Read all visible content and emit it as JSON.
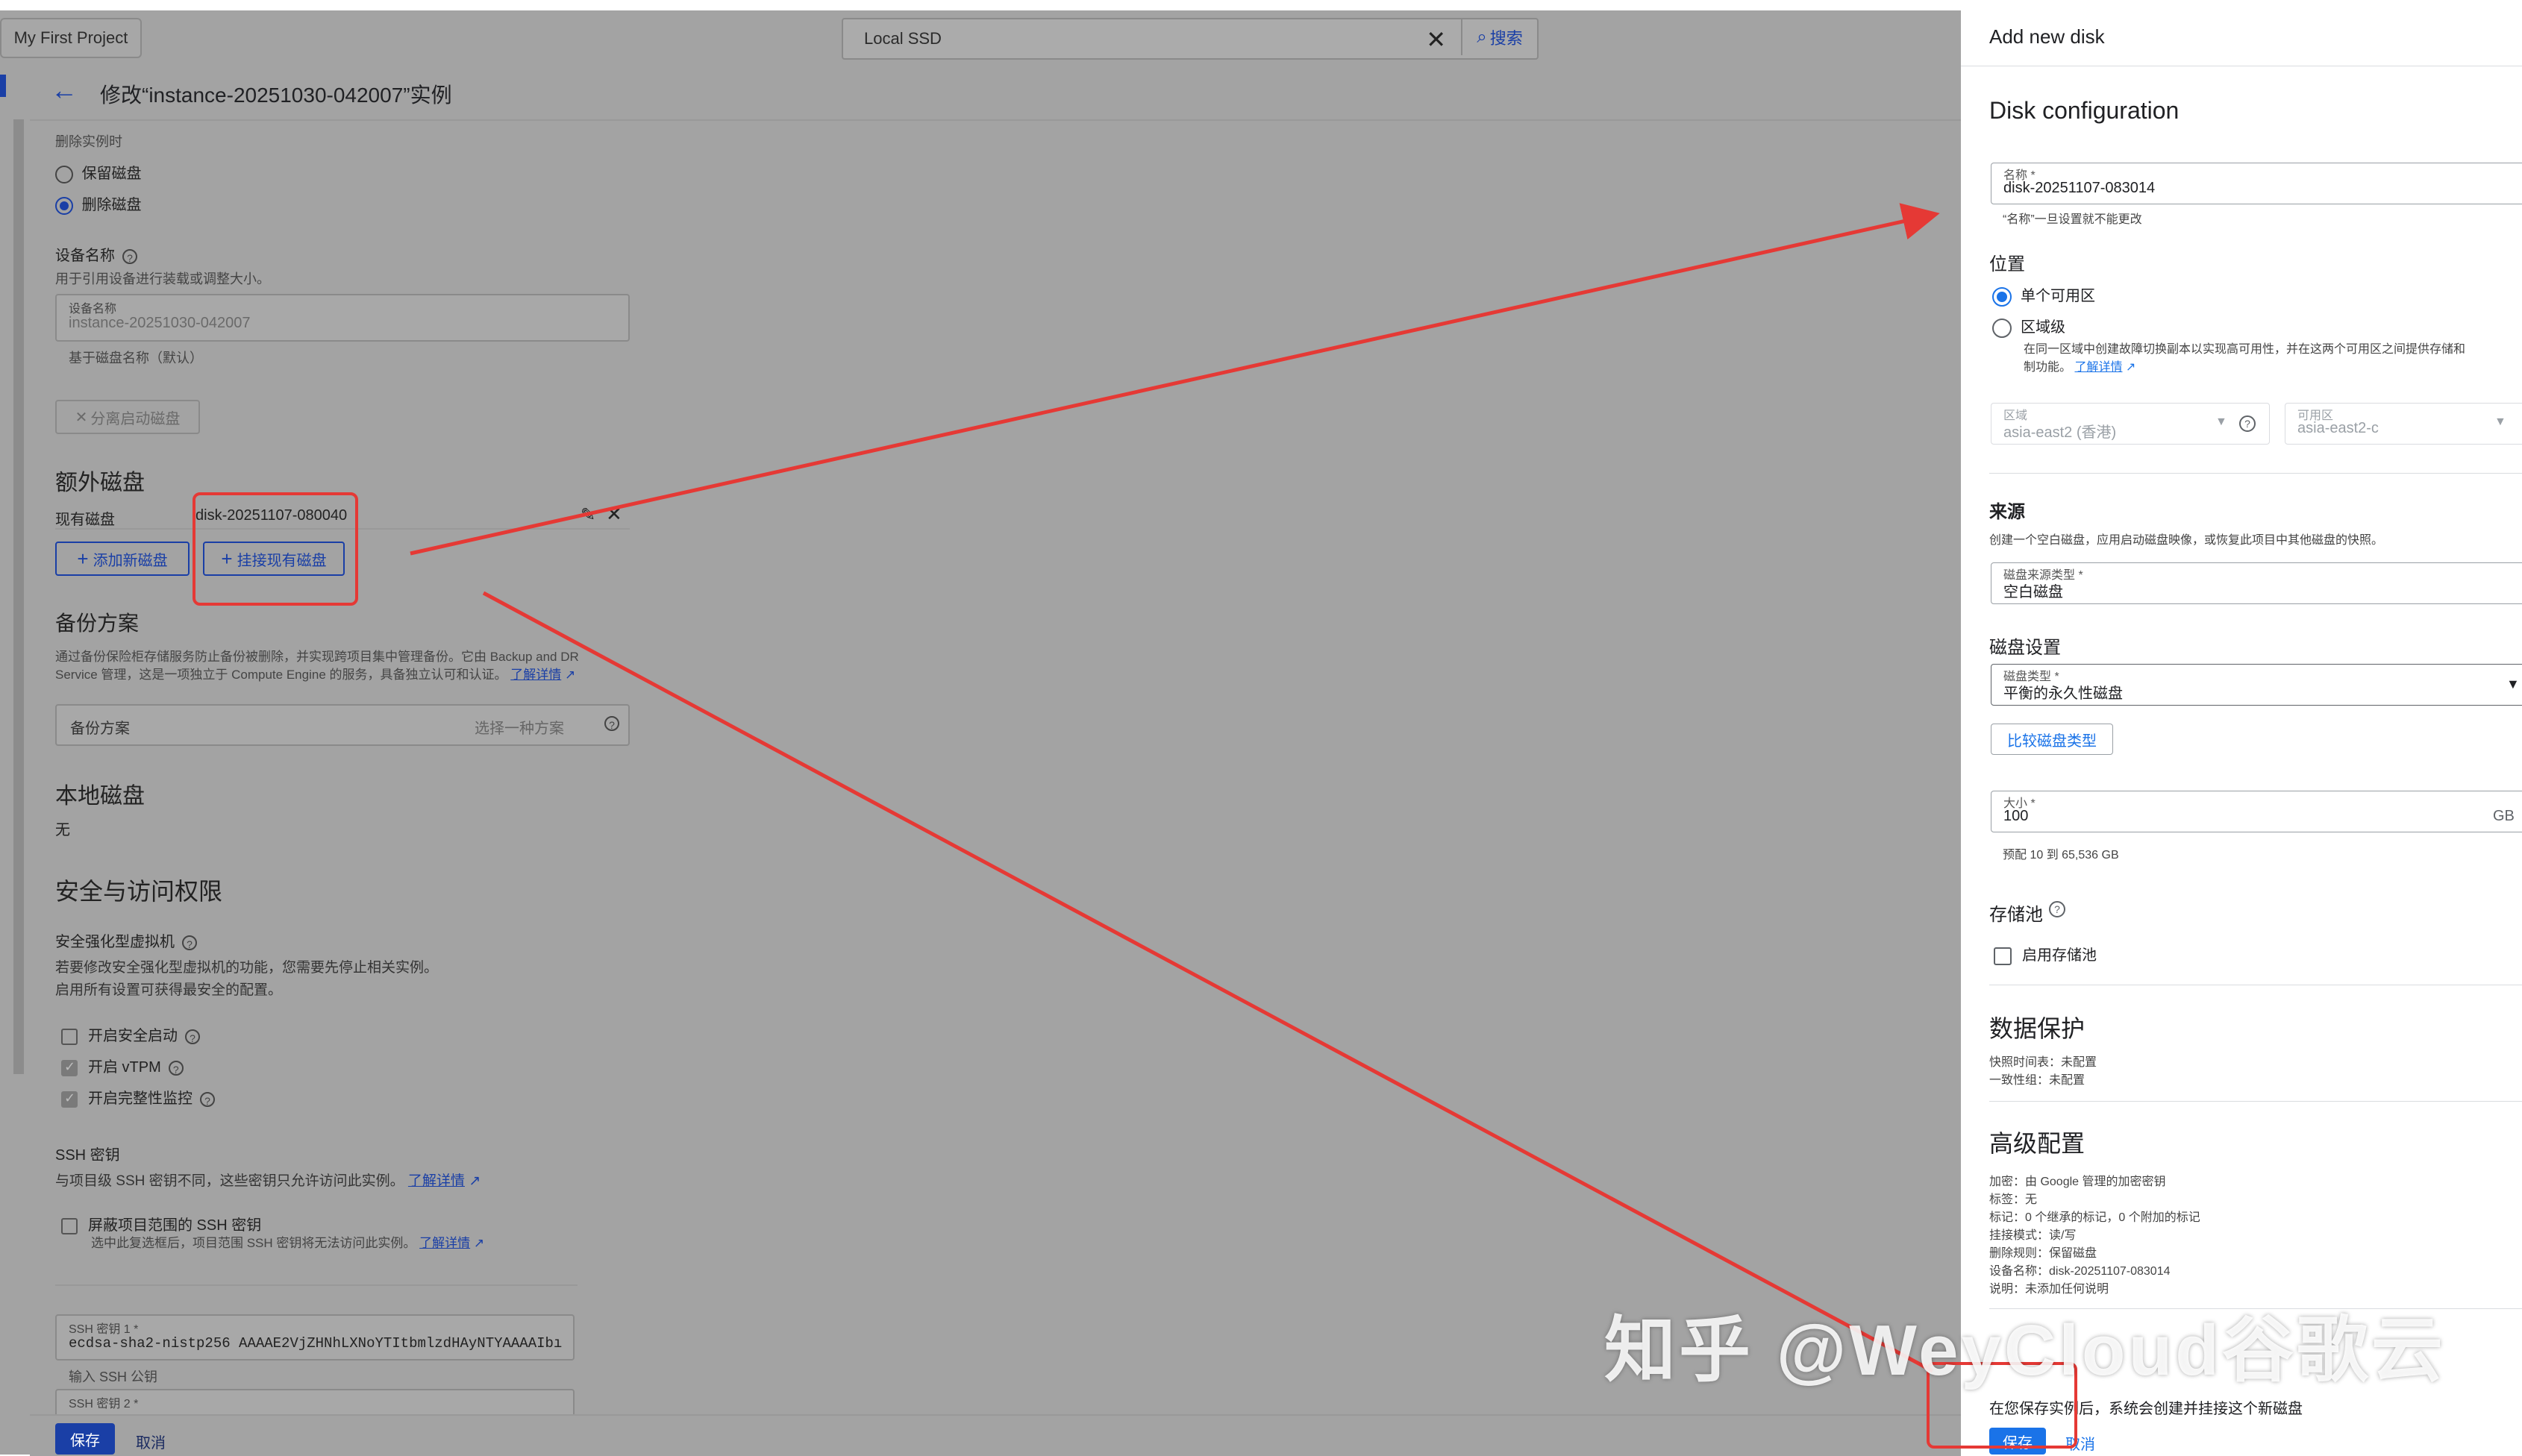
{
  "topbar": {
    "project": "My First Project",
    "search_value": "Local SSD",
    "search_button": "搜索"
  },
  "header": {
    "title": "修改“instance-20251030-042007”实例"
  },
  "delete_rule": {
    "caption": "删除实例时",
    "options": [
      "保留磁盘",
      "删除磁盘"
    ],
    "selected": "删除磁盘"
  },
  "device_name": {
    "title": "设备名称",
    "desc": "用于引用设备进行装载或调整大小。",
    "field_label": "设备名称",
    "field_value": "instance-20251030-042007",
    "hint": "基于磁盘名称（默认）",
    "detach_button": "分离启动磁盘"
  },
  "extra_disks": {
    "title": "额外磁盘",
    "existing_label": "现有磁盘",
    "existing_value": "disk-20251107-080040",
    "add_new": "添加新磁盘",
    "attach_existing": "挂接现有磁盘"
  },
  "backup": {
    "title": "备份方案",
    "desc1": "通过备份保险柜存储服务防止备份被删除，并实现跨项目集中管理备份。它由 Backup and DR",
    "desc2": "Service 管理，这是一项独立于 Compute Engine 的服务，具备独立认可和认证。",
    "learn_more": "了解详情",
    "field_label": "备份方案",
    "field_placeholder": "选择一种方案"
  },
  "local_disk": {
    "title": "本地磁盘",
    "value": "无"
  },
  "security": {
    "title": "安全与访问权限",
    "shielded_title": "安全强化型虚拟机",
    "shielded_desc1": "若要修改安全强化型虚拟机的功能，您需要先停止相关实例。",
    "shielded_desc2": "启用所有设置可获得最安全的配置。",
    "checks": [
      {
        "label": "开启安全启动",
        "checked": false
      },
      {
        "label": "开启 vTPM",
        "checked": true
      },
      {
        "label": "开启完整性监控",
        "checked": true
      }
    ],
    "ssh_title": "SSH 密钥",
    "ssh_desc": "与项目级 SSH 密钥不同，这些密钥只允许访问此实例。",
    "ssh_learn": "了解详情",
    "block_label": "屏蔽项目范围的 SSH 密钥",
    "block_desc": "选中此复选框后，项目范围 SSH 密钥将无法访问此实例。",
    "block_learn": "了解详情",
    "ssh1_label": "SSH 密钥 1 *",
    "ssh1_value": "ecdsa-sha2-nistp256 AAAAE2VjZHNhLXNoYTItbmlzdHAyNTYAAAAIbı",
    "ssh1_hint": "输入 SSH 公钥",
    "ssh2_label": "SSH 密钥 2 *"
  },
  "footer": {
    "save": "保存",
    "cancel": "取消"
  },
  "panel": {
    "header": "Add new disk",
    "section": "Disk configuration",
    "name_label": "名称 *",
    "name_value": "disk-20251107-083014",
    "name_hint": "“名称”一旦设置就不能更改",
    "location_title": "位置",
    "loc_single": "单个可用区",
    "loc_regional": "区域级",
    "loc_regional_desc1": "在同一区域中创建故障切换副本以实现高可用性，并在这两个可用区之间提供存储和",
    "loc_regional_desc2": "制功能。",
    "loc_learn": "了解详情",
    "region_label": "区域",
    "region_value": "asia-east2 (香港)",
    "zone_label": "可用区",
    "zone_value": "asia-east2-c",
    "source_title": "来源",
    "source_desc": "创建一个空白磁盘，应用启动磁盘映像，或恢复此项目中其他磁盘的快照。",
    "source_type_label": "磁盘来源类型 *",
    "source_type_value": "空白磁盘",
    "disk_settings_title": "磁盘设置",
    "disk_type_label": "磁盘类型 *",
    "disk_type_value": "平衡的永久性磁盘",
    "compare_button": "比较磁盘类型",
    "size_label": "大小 *",
    "size_value": "100",
    "size_unit": "GB",
    "size_hint": "预配 10 到 65,536 GB",
    "pool_title": "存储池",
    "pool_check": "启用存储池",
    "protection_title": "数据保护",
    "snapshot_line": "快照时间表：未配置",
    "consistency_line": "一致性组：未配置",
    "advanced_title": "高级配置",
    "advanced_lines": [
      "加密：由 Google 管理的加密密钥",
      "标签：无",
      "标记：0 个继承的标记，0 个附加的标记",
      "挂接模式：读/写",
      "删除规则：保留磁盘",
      "设备名称：disk-20251107-083014",
      "说明：未添加任何说明"
    ],
    "notice": "在您保存实例后，系统会创建并挂接这个新磁盘",
    "save": "保存",
    "cancel": "取消"
  },
  "watermark": "知乎 @WeyCloud谷歌云"
}
